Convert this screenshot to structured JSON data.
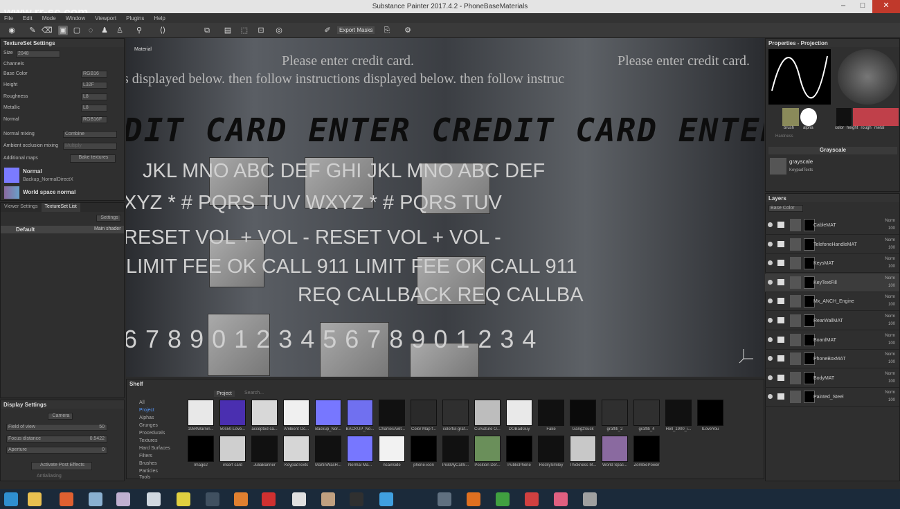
{
  "window": {
    "title": "Substance Painter 2017.4.2 - PhoneBaseMaterials",
    "watermark": "www.rr-sc.com"
  },
  "menu": [
    "File",
    "Edit",
    "Mode",
    "Window",
    "Viewport",
    "Plugins",
    "Help"
  ],
  "toolbar": {
    "export_masks": "Export Masks"
  },
  "textureset": {
    "title": "TextureSet Settings",
    "size_label": "Size",
    "size_value": "2048",
    "channels_label": "Channels",
    "channels": [
      {
        "name": "Base Color",
        "fmt": "RGB16"
      },
      {
        "name": "Height",
        "fmt": "L32F"
      },
      {
        "name": "Roughness",
        "fmt": "L8"
      },
      {
        "name": "Metallic",
        "fmt": "L8"
      },
      {
        "name": "Normal",
        "fmt": "RGB16F"
      }
    ],
    "normal_mixing_label": "Normal mixing",
    "normal_mixing_value": "Combine",
    "ao_mixing_label": "Ambient occlusion mixing",
    "ao_mixing_value": "Multiply",
    "additional_maps": "Additional maps",
    "bake": "Bake textures",
    "maps": [
      {
        "name": "Normal",
        "file": "Backup_NormalDirectX"
      },
      {
        "name": "World space normal",
        "file": ""
      }
    ]
  },
  "tabs": {
    "viewer": "Viewer Settings",
    "texlist": "TextureSet List",
    "settings": "Settings",
    "default_item": "Default",
    "shader": "Main shader"
  },
  "display": {
    "title": "Display Settings",
    "camera": "Camera",
    "fov_label": "Field of view",
    "fov_value": "50",
    "focus_label": "Focus distance",
    "focus_value": "0.5422",
    "aperture_label": "Aperture",
    "aperture_value": "0",
    "post": "Activate Post Effects",
    "antialias": "Antialiasing"
  },
  "viewport": {
    "tab": "Material",
    "lines": [
      "Please enter credit card.",
      "Please enter credit card.",
      "s displayed below. then follow instructions displayed below. then follow instruc"
    ],
    "lcd": "DIT CARD ENTER CREDIT CARD ENTER CR",
    "kp1": "JKL  MNO      ABC  DEF    GHI  JKL  MNO        ABC  DEF",
    "kp2": "XYZ  *  #         PQRS   TUV    WXYZ  *  #         PQRS  TUV",
    "kp3": "RESET             VOL +  VOL -  RESET               VOL +  VOL -",
    "kp4": "LIMIT FEE        OK CALL 911   LIMIT FEE         OK CALL 911",
    "kp5": "REQ CALLBACK                    REQ CALLBA",
    "digits": "6 7 8 9 0 1 2 3 4 5 6 7 8 9 0 1 2 3 4"
  },
  "shelf": {
    "title": "Shelf",
    "tab": "Project",
    "search": "Search...",
    "categories": [
      "All",
      "Project",
      "Alphas",
      "Grunges",
      "Procedurals",
      "Textures",
      "Hard Surfaces",
      "Filters",
      "Brushes",
      "Particles",
      "Tools"
    ],
    "items1": [
      {
        "label": "1984Warnin...",
        "color": "#e8e8e8"
      },
      {
        "label": "50s50-Love...",
        "color": "#4a2fb0"
      },
      {
        "label": "accepted ca...",
        "color": "#d8d8d8"
      },
      {
        "label": "Ambient Oc...",
        "color": "#f0f0f0"
      },
      {
        "label": "Backup_Nor...",
        "color": "#7777ff"
      },
      {
        "label": "BACKUP_No...",
        "color": "#7070f0"
      },
      {
        "label": "CharliesABit...",
        "color": "#111111"
      },
      {
        "label": "Color Map f...",
        "color": "#2a2a2a"
      },
      {
        "label": "colorful-graf...",
        "color": "#2f2f2f"
      },
      {
        "label": "Curvature O...",
        "color": "#bdbdbd"
      },
      {
        "label": "DOBadGuy",
        "color": "#e9e9e9"
      },
      {
        "label": "Fake",
        "color": "#111111"
      },
      {
        "label": "GangzSuck",
        "color": "#0a0a0a"
      },
      {
        "label": "graffiti_2",
        "color": "#2f2f2f"
      },
      {
        "label": "graffiti_4",
        "color": "#2f2f2f"
      },
      {
        "label": "Hell_1900_i...",
        "color": "#111111"
      },
      {
        "label": "ILoveYou",
        "color": "#000000"
      }
    ],
    "items2": [
      {
        "label": "Image2",
        "color": "#000000"
      },
      {
        "label": "insert card",
        "color": "#cfcfcf"
      },
      {
        "label": "JuliaBanner",
        "color": "#111111"
      },
      {
        "label": "KeypadTexts",
        "color": "#d6d6d6"
      },
      {
        "label": "MartinWasH...",
        "color": "#111111"
      },
      {
        "label": "Normal Ma...",
        "color": "#7777ff"
      },
      {
        "label": "nsainside",
        "color": "#f2f2f2"
      },
      {
        "label": "phone-icon",
        "color": "#000000"
      },
      {
        "label": "PickMyCallS...",
        "color": "#111111"
      },
      {
        "label": "Position Def...",
        "color": "#6a8f5a"
      },
      {
        "label": "PublicPhone",
        "color": "#000000"
      },
      {
        "label": "RockySmiley",
        "color": "#111111"
      },
      {
        "label": "Thickness M...",
        "color": "#c8c8c8"
      },
      {
        "label": "World Spac...",
        "color": "#8a6aa0"
      },
      {
        "label": "ZombiePower",
        "color": "#000000"
      }
    ]
  },
  "properties": {
    "title": "Properties - Projection",
    "brush": "brush",
    "alpha": "alpha",
    "color": "color",
    "height": "height",
    "rough": "rough",
    "metal": "metal",
    "hardness": "Hardness",
    "grayscale_title": "Grayscale",
    "grayscale": "grayscale",
    "grayscale_sub": "KeypadTexts"
  },
  "layers": {
    "title": "Layers",
    "channel": "Base Color",
    "items": [
      {
        "name": "CableMAT",
        "blend": "Norm",
        "op": "100"
      },
      {
        "name": "TelefoneHandleMAT",
        "blend": "Norm",
        "op": "100"
      },
      {
        "name": "KeysMAT",
        "blend": "Norm",
        "op": "100"
      },
      {
        "name": "KeyTextFill",
        "blend": "Norm",
        "op": "100"
      },
      {
        "name": "Mx_ANCH_Engine",
        "blend": "Norm",
        "op": "100"
      },
      {
        "name": "RearWallMAT",
        "blend": "Norm",
        "op": "100"
      },
      {
        "name": "BoardMAT",
        "blend": "Norm",
        "op": "100"
      },
      {
        "name": "PhoneBoxMAT",
        "blend": "Norm",
        "op": "100"
      },
      {
        "name": "BodyMAT",
        "blend": "Norm",
        "op": "100"
      },
      {
        "name": "Painted_Steel",
        "blend": "Norm",
        "op": "100"
      }
    ]
  }
}
